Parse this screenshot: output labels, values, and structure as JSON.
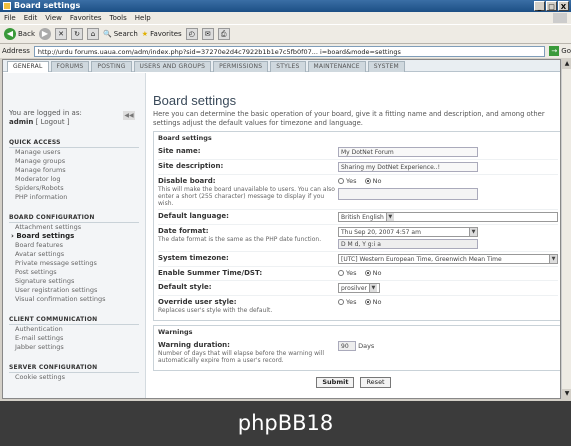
{
  "window": {
    "title": "Board settings",
    "controls": [
      "_",
      "□",
      "X"
    ]
  },
  "menu": [
    "File",
    "Edit",
    "View",
    "Favorites",
    "Tools",
    "Help"
  ],
  "toolbar": {
    "back": "Back",
    "search": "Search",
    "favorites": "Favorites"
  },
  "address": {
    "label": "Address",
    "url": "http://urdu forums.uaua.com/adm/index.php?sid=37270e2d4c7922b1b1e7c5fb0f07... i=board&mode=settings",
    "go": "Go"
  },
  "tabs": [
    {
      "label": "GENERAL",
      "active": true
    },
    {
      "label": "FORUMS",
      "active": false
    },
    {
      "label": "POSTING",
      "active": false
    },
    {
      "label": "USERS AND GROUPS",
      "active": false
    },
    {
      "label": "PERMISSIONS",
      "active": false
    },
    {
      "label": "STYLES",
      "active": false
    },
    {
      "label": "MAINTENANCE",
      "active": false
    },
    {
      "label": "SYSTEM",
      "active": false
    }
  ],
  "sidebar": {
    "logged_in_line": "You are logged in as:",
    "user": "admin",
    "logout": "[ Logout ]",
    "sections": [
      {
        "title": "QUICK ACCESS",
        "items": [
          "Manage users",
          "Manage groups",
          "Manage forums",
          "Moderator log",
          "Spiders/Robots",
          "PHP information"
        ]
      },
      {
        "title": "BOARD CONFIGURATION",
        "items": [
          "Attachment settings",
          "Board settings",
          "Board features",
          "Avatar settings",
          "Private message settings",
          "Post settings",
          "Signature settings",
          "User registration settings",
          "Visual confirmation settings"
        ]
      },
      {
        "title": "CLIENT COMMUNICATION",
        "items": [
          "Authentication",
          "E-mail settings",
          "Jabber settings"
        ]
      },
      {
        "title": "SERVER CONFIGURATION",
        "items": [
          "Cookie settings"
        ]
      }
    ],
    "active_item": "Board settings"
  },
  "main": {
    "title": "Board settings",
    "intro": "Here you can determine the basic operation of your board, give it a fitting name and description, and among other settings adjust the default values for timezone and language.",
    "legend": "Board settings",
    "rows": {
      "site_name": {
        "label": "Site name:",
        "value": "My DotNet Forum"
      },
      "site_desc": {
        "label": "Site description:",
        "value": "Sharing my DotNet Experience..!"
      },
      "disable": {
        "label": "Disable board:",
        "explain": "This will make the board unavailable to users. You can also enter a short (255 character) message to display if you wish.",
        "yes": "Yes",
        "no": "No"
      },
      "language": {
        "label": "Default language:",
        "value": "British English"
      },
      "date": {
        "label": "Date format:",
        "explain": "The date format is the same as the PHP date function.",
        "value": "Thu Sep 20, 2007 4:57 am",
        "format": "D M d, Y g:i a"
      },
      "timezone": {
        "label": "System timezone:",
        "value": "[UTC] Western European Time, Greenwich Mean Time"
      },
      "dst": {
        "label": "Enable Summer Time/DST:",
        "yes": "Yes",
        "no": "No"
      },
      "style": {
        "label": "Default style:",
        "value": "prosilver"
      },
      "override": {
        "label": "Override user style:",
        "explain": "Replaces user's style with the default.",
        "yes": "Yes",
        "no": "No"
      }
    },
    "warnings": {
      "legend": "Warnings",
      "label": "Warning duration:",
      "explain": "Number of days that will elapse before the warning will automatically expire from a user's record.",
      "value": "90",
      "unit": "Days"
    },
    "submit": "Submit",
    "reset": "Reset"
  },
  "caption": "phpBB18"
}
